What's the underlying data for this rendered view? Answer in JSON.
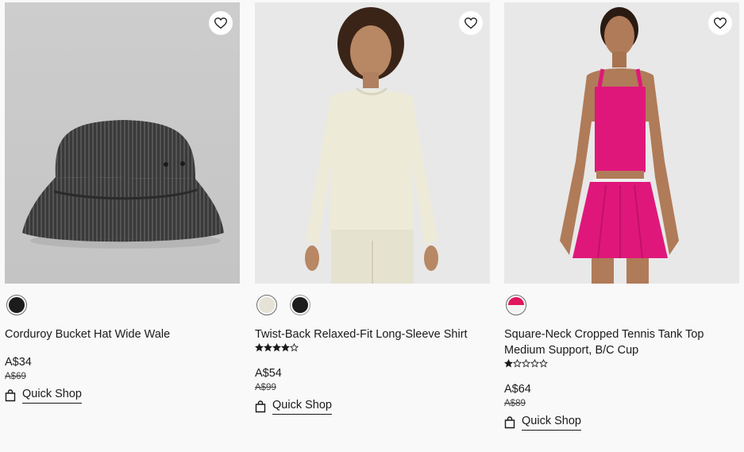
{
  "products": [
    {
      "title": "Corduroy Bucket Hat Wide Wale",
      "price": "A$34",
      "was_price": "A$69",
      "quick_shop": "Quick Shop",
      "rating": null,
      "swatches": [
        "#1c1c1c"
      ],
      "image": "bucket-hat-photo"
    },
    {
      "title": "Twist-Back Relaxed-Fit Long-Sleeve Shirt",
      "price": "A$54",
      "was_price": "A$99",
      "quick_shop": "Quick Shop",
      "rating": 4,
      "swatches": [
        "#e6e2d6",
        "#1c1c1c"
      ],
      "image": "long-sleeve-shirt-photo"
    },
    {
      "title": "Square-Neck Cropped Tennis Tank Top Medium Support, B/C Cup",
      "price": "A$64",
      "was_price": "A$89",
      "quick_shop": "Quick Shop",
      "rating": 1,
      "swatches": [
        "#e0165f"
      ],
      "image": "tennis-tank-top-photo"
    }
  ],
  "colors": {
    "background": "#f9f9f9",
    "text": "#1a1a1a",
    "image_bg": "#e5e5e5"
  },
  "icons": {
    "wishlist": "heart-icon",
    "quick_shop": "shopping-bag-icon",
    "rating": "star-icon"
  }
}
